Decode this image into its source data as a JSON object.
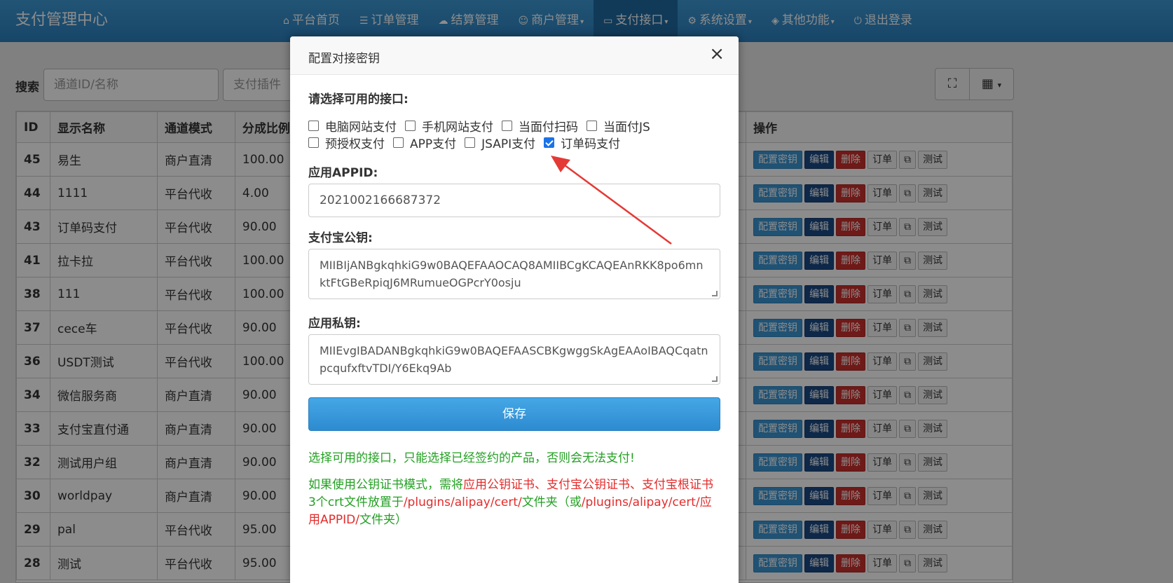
{
  "brand": "支付管理中心",
  "nav": [
    {
      "icon": "home-icon",
      "glyph": "⌂",
      "label": "平台首页",
      "caret": ""
    },
    {
      "icon": "list-icon",
      "glyph": "☰",
      "label": "订单管理",
      "caret": ""
    },
    {
      "icon": "cloud-icon",
      "glyph": "☁",
      "label": "结算管理",
      "caret": ""
    },
    {
      "icon": "user-icon",
      "glyph": "☺",
      "label": "商户管理",
      "caret": "▾"
    },
    {
      "icon": "credit-card-icon",
      "glyph": "▭",
      "label": "支付接口",
      "caret": "▾"
    },
    {
      "icon": "gear-icon",
      "glyph": "⚙",
      "label": "系统设置",
      "caret": "▾"
    },
    {
      "icon": "cube-icon",
      "glyph": "◈",
      "label": "其他功能",
      "caret": "▾"
    },
    {
      "icon": "power-icon",
      "glyph": "⏻",
      "label": "退出登录",
      "caret": ""
    }
  ],
  "search": {
    "label": "搜索",
    "placeholder": "通道ID/名称",
    "plugin_placeholder": "支付插件"
  },
  "table": {
    "headers": [
      "ID",
      "显示名称",
      "通道模式",
      "分成比例"
    ],
    "ops_header": "操作",
    "rows": [
      {
        "id": "45",
        "name": "易生",
        "mode": "商户直清",
        "rate": "100.00"
      },
      {
        "id": "44",
        "name": "1111",
        "mode": "平台代收",
        "rate": "4.00"
      },
      {
        "id": "43",
        "name": "订单码支付",
        "mode": "平台代收",
        "rate": "90.00"
      },
      {
        "id": "41",
        "name": "拉卡拉",
        "mode": "平台代收",
        "rate": "100.00"
      },
      {
        "id": "38",
        "name": "111",
        "mode": "平台代收",
        "rate": "100.00"
      },
      {
        "id": "37",
        "name": "cece车",
        "mode": "平台代收",
        "rate": "90.00"
      },
      {
        "id": "36",
        "name": "USDT测试",
        "mode": "平台代收",
        "rate": "100.00"
      },
      {
        "id": "34",
        "name": "微信服务商",
        "mode": "商户直清",
        "rate": "90.00"
      },
      {
        "id": "33",
        "name": "支付宝直付通",
        "mode": "商户直清",
        "rate": "90.00"
      },
      {
        "id": "32",
        "name": "测试用户组",
        "mode": "商户直清",
        "rate": "90.00"
      },
      {
        "id": "30",
        "name": "worldpay",
        "mode": "商户直清",
        "rate": "90.00"
      },
      {
        "id": "29",
        "name": "pal",
        "mode": "平台代收",
        "rate": "95.00"
      },
      {
        "id": "28",
        "name": "测试",
        "mode": "平台代收",
        "rate": "95.00"
      }
    ],
    "ops": {
      "key": "配置密钥",
      "edit": "编辑",
      "del": "删除",
      "order": "订单",
      "copy": "⧉",
      "test": "测试"
    }
  },
  "modal": {
    "title": "配置对接密钥",
    "close": "×",
    "interfaces_label": "请选择可用的接口:",
    "interfaces": [
      {
        "label": "电脑网站支付",
        "checked": false
      },
      {
        "label": "手机网站支付",
        "checked": false
      },
      {
        "label": "当面付扫码",
        "checked": false
      },
      {
        "label": "当面付JS",
        "checked": false
      },
      {
        "label": "预授权支付",
        "checked": false
      },
      {
        "label": "APP支付",
        "checked": false
      },
      {
        "label": "JSAPI支付",
        "checked": false
      },
      {
        "label": "订单码支付",
        "checked": true
      }
    ],
    "appid_label": "应用APPID:",
    "appid_value": "2021002166687372",
    "pubkey_label": "支付宝公钥:",
    "pubkey_value": "MIIBIjANBgkqhkiG9w0BAQEFAAOCAQ8AMIIBCgKCAQEAnRKK8po6mnktFtGBeRpiqJ6MRumueOGPcrY0osju",
    "privkey_label": "应用私钥:",
    "privkey_value": "MIIEvgIBADANBgkqhkiG9w0BAQEFAASCBKgwggSkAgEAAoIBAQCqatnpcqufxftvTDI/Y6Ekq9Ab",
    "save": "保存",
    "note1": "选择可用的接口，只能选择已经签约的产品，否则会无法支付!",
    "note2_parts": [
      {
        "text": "如果使用公钥证书模式，需将",
        "color": "green"
      },
      {
        "text": "应用公钥证书、支付宝公钥证书、支付宝根证书",
        "color": "red"
      },
      {
        "text": "3个crt文件放置于",
        "color": "green"
      },
      {
        "text": "/plugins/alipay/cert/",
        "color": "red"
      },
      {
        "text": "文件夹（或",
        "color": "green"
      },
      {
        "text": "/plugins/alipay/cert/应用APPID/",
        "color": "red"
      },
      {
        "text": "文件夹）",
        "color": "green"
      }
    ]
  },
  "colors": {
    "navbar": "#2b7fbe",
    "arrow": "#e53935",
    "note_green": "#22a022",
    "note_red": "#e42b2b"
  }
}
